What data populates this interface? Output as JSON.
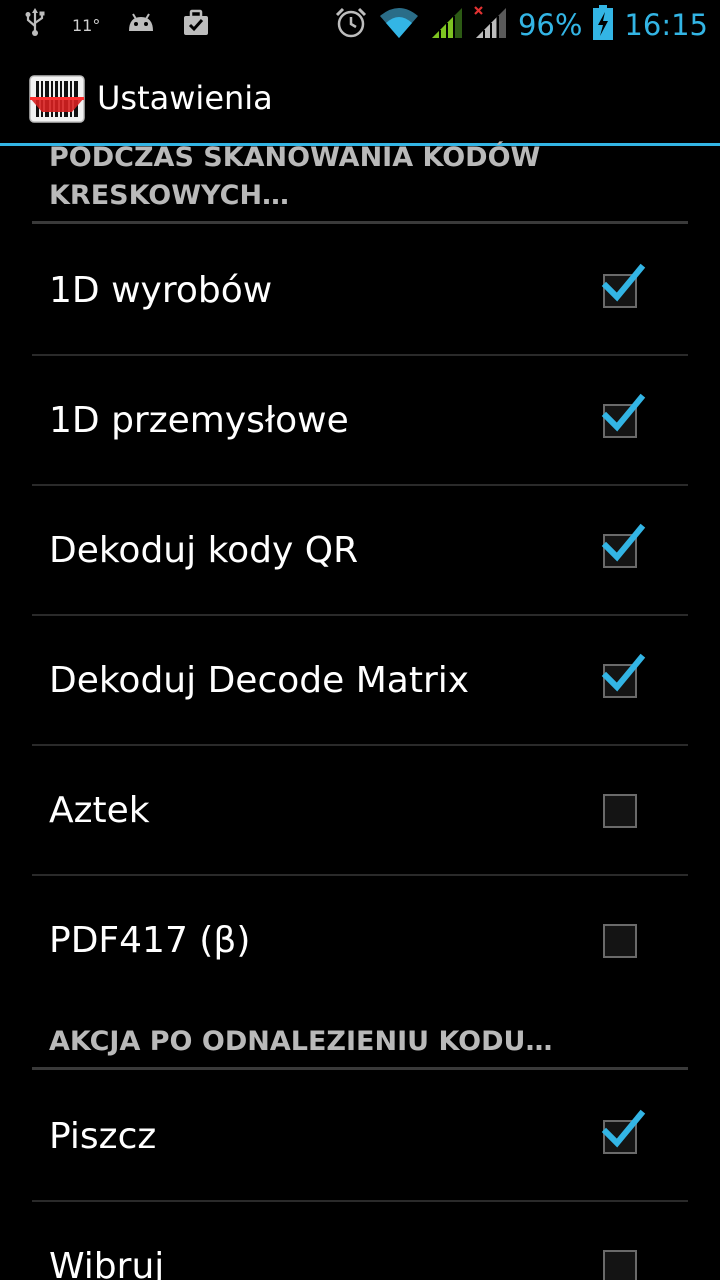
{
  "status_bar": {
    "usb_icon": "usb-icon",
    "temperature": "11°",
    "android_icon": "android-icon",
    "task_icon": "briefcase-check-icon",
    "alarm_icon": "alarm-icon",
    "wifi_icon": "wifi-icon",
    "signal_icon": "signal-icon",
    "signal2_icon": "signal-no-data-icon",
    "battery_percent": "96%",
    "battery_icon": "battery-charging-icon",
    "time": "16:15",
    "accent_color": "#33b5e5"
  },
  "action_bar": {
    "app_icon": "barcode-scanner-icon",
    "title": "Ustawienia"
  },
  "sections": [
    {
      "header": "PODCZAS SKANOWANIA KODÓW KRESKOWYCH…",
      "items": [
        {
          "label": "1D wyrobów",
          "checked": true
        },
        {
          "label": "1D przemysłowe",
          "checked": true
        },
        {
          "label": "Dekoduj kody QR",
          "checked": true
        },
        {
          "label": "Dekoduj Decode Matrix",
          "checked": true
        },
        {
          "label": "Aztek",
          "checked": false
        },
        {
          "label": "PDF417 (β)",
          "checked": false
        }
      ]
    },
    {
      "header": "AKCJA PO ODNALEZIENIU KODU…",
      "items": [
        {
          "label": "Piszcz",
          "checked": true
        },
        {
          "label": "Wibruj",
          "checked": false
        }
      ]
    }
  ]
}
